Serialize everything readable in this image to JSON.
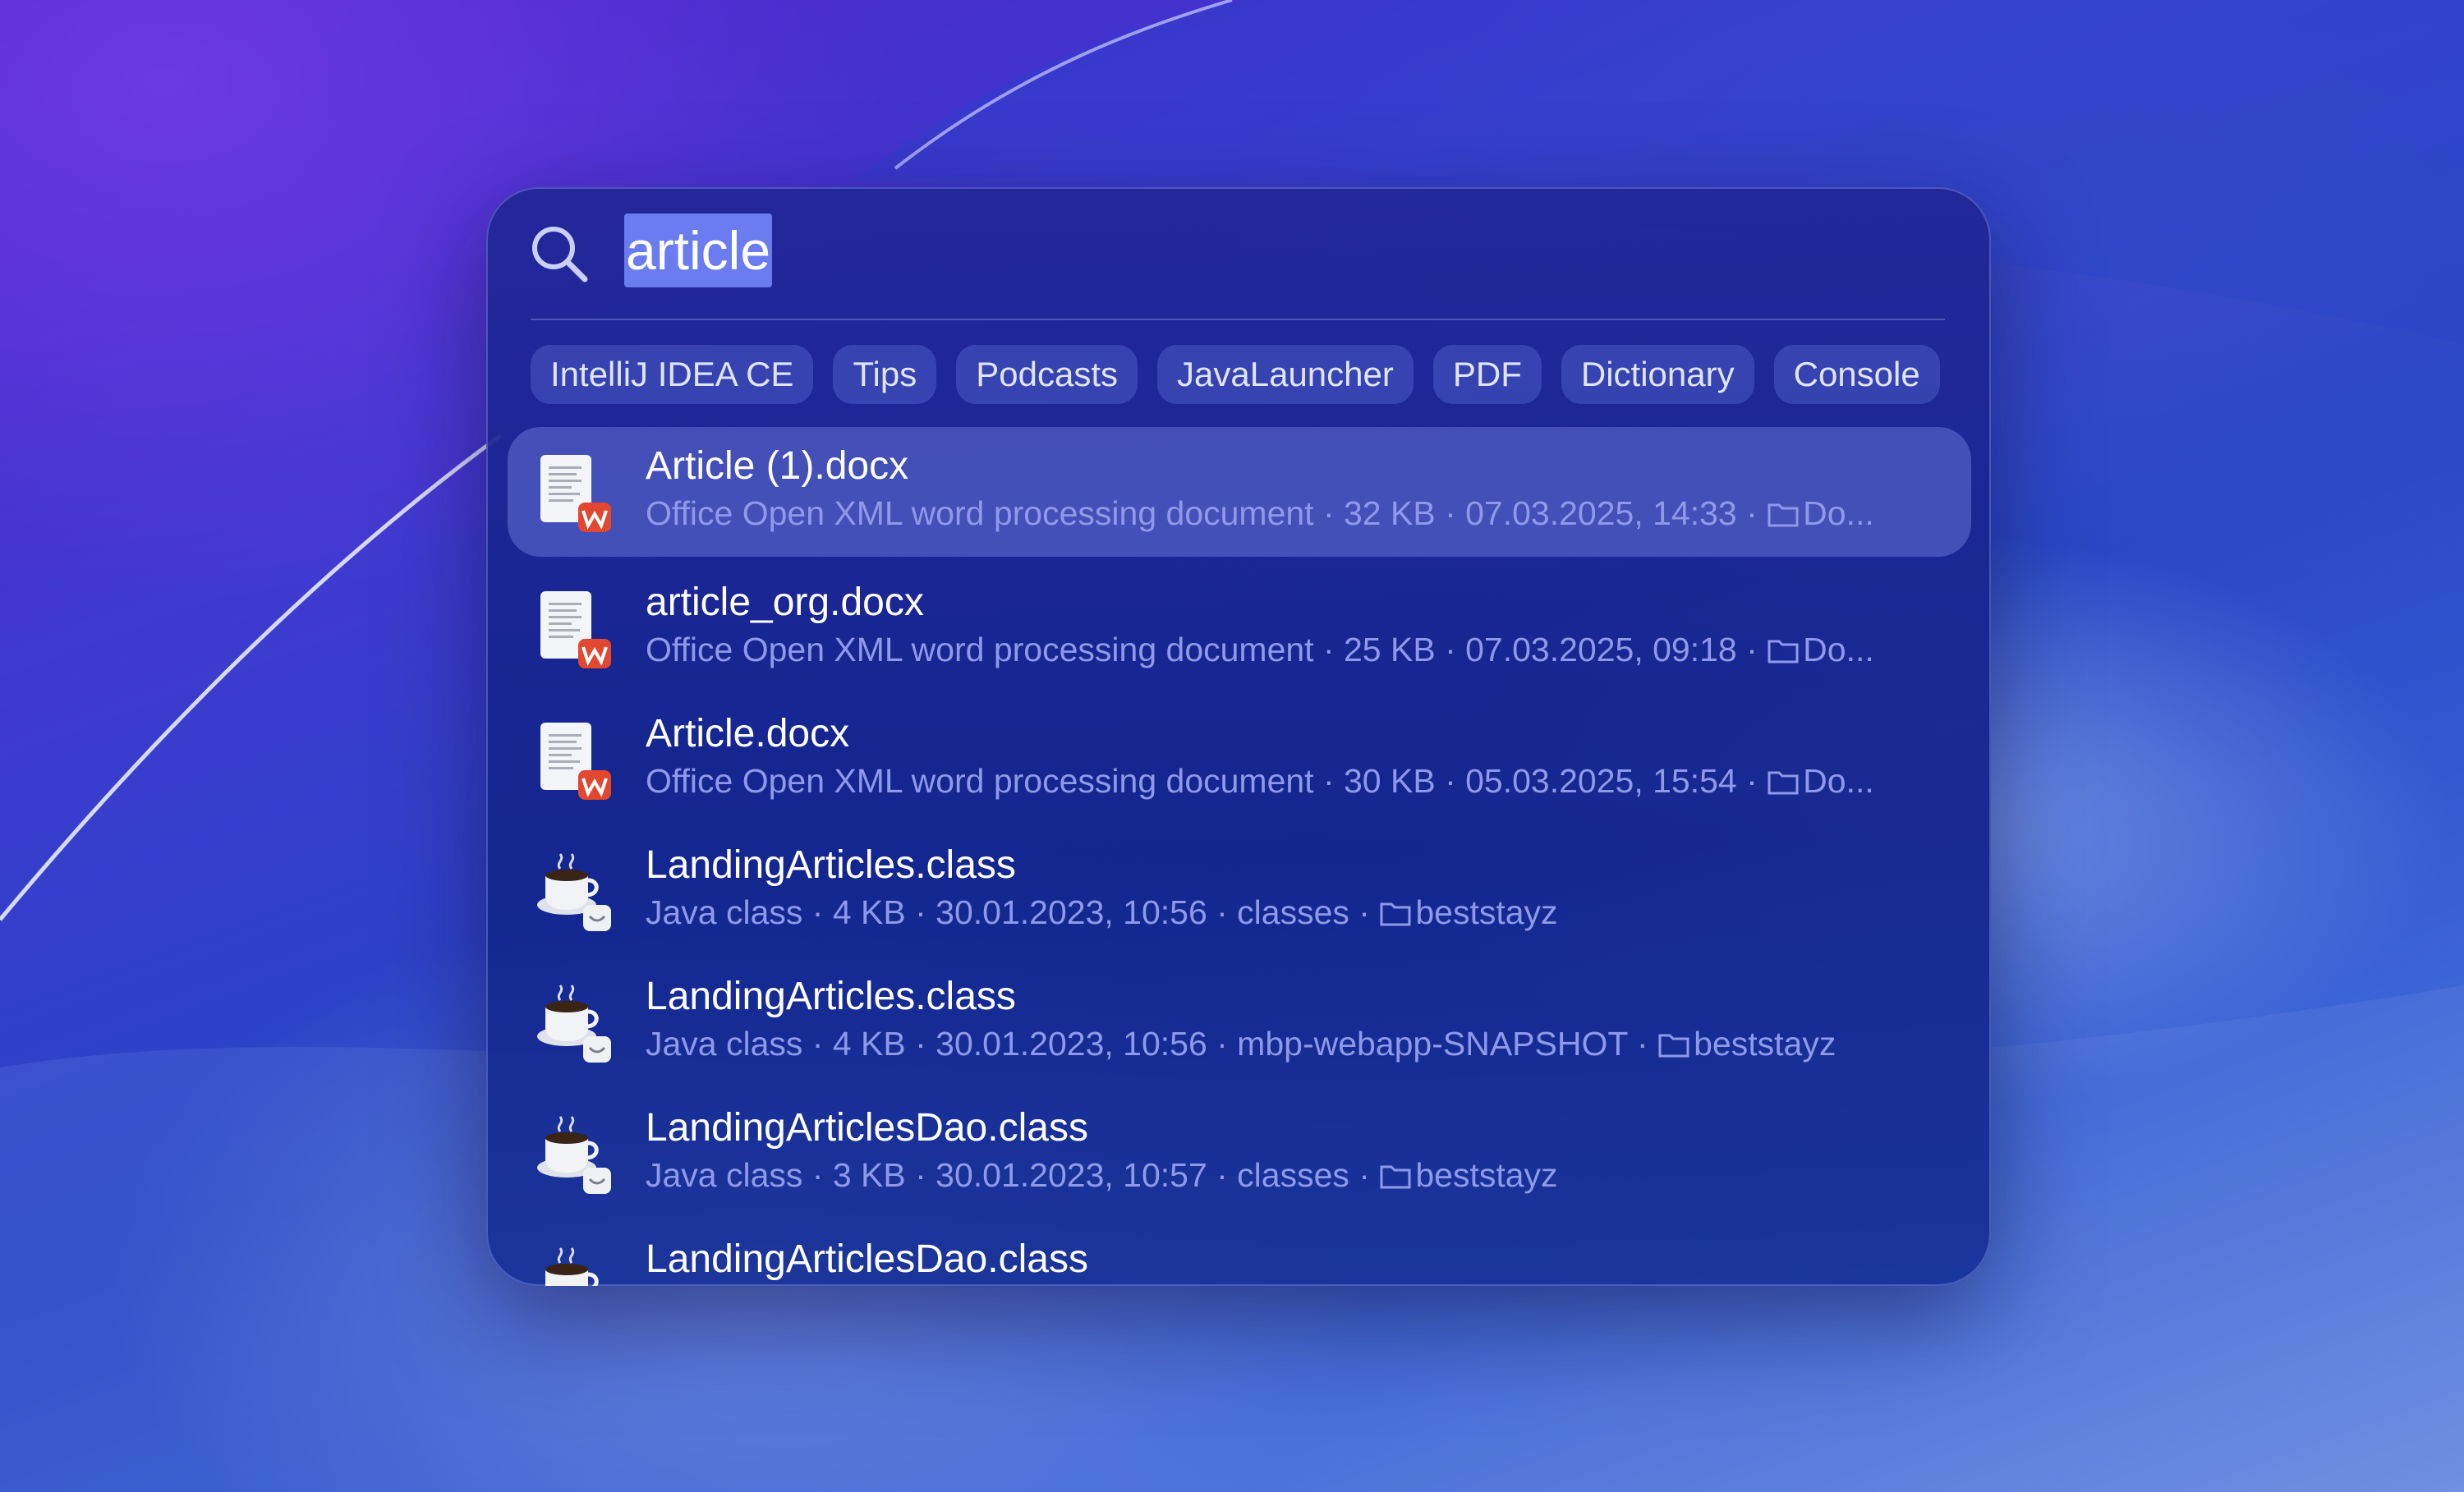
{
  "search": {
    "query": "article"
  },
  "chips": [
    "IntelliJ IDEA CE",
    "Tips",
    "Podcasts",
    "JavaLauncher",
    "PDF",
    "Dictionary",
    "Console"
  ],
  "results": [
    {
      "title": "Article (1).docx",
      "meta": "Office Open XML word processing document · 32 KB · 07.03.2025, 14:33 ·",
      "folder": "Do...",
      "icon": "docx-icon",
      "selected": true
    },
    {
      "title": "article_org.docx",
      "meta": "Office Open XML word processing document · 25 KB · 07.03.2025, 09:18 ·",
      "folder": "Do...",
      "icon": "docx-icon"
    },
    {
      "title": "Article.docx",
      "meta": "Office Open XML word processing document · 30 KB · 05.03.2025, 15:54 ·",
      "folder": "Do...",
      "icon": "docx-icon"
    },
    {
      "title": "LandingArticles.class",
      "meta": "Java class · 4 KB · 30.01.2023, 10:56 · classes ·",
      "folder": "beststayz",
      "icon": "java-class-icon"
    },
    {
      "title": "LandingArticles.class",
      "meta": "Java class · 4 KB · 30.01.2023, 10:56 · mbp-webapp-SNAPSHOT ·",
      "folder": "beststayz",
      "icon": "java-class-icon"
    },
    {
      "title": "LandingArticlesDao.class",
      "meta": "Java class · 3 KB · 30.01.2023, 10:57 · classes ·",
      "folder": "beststayz",
      "icon": "java-class-icon"
    },
    {
      "title": "LandingArticlesDao.class",
      "meta": "",
      "folder": "",
      "icon": "java-class-icon"
    }
  ],
  "colors": {
    "selection_highlight": "#6a7cf0",
    "title_text": "#ffffff",
    "meta_text": "#8e9ae8",
    "docx_badge": "#e2472f"
  }
}
